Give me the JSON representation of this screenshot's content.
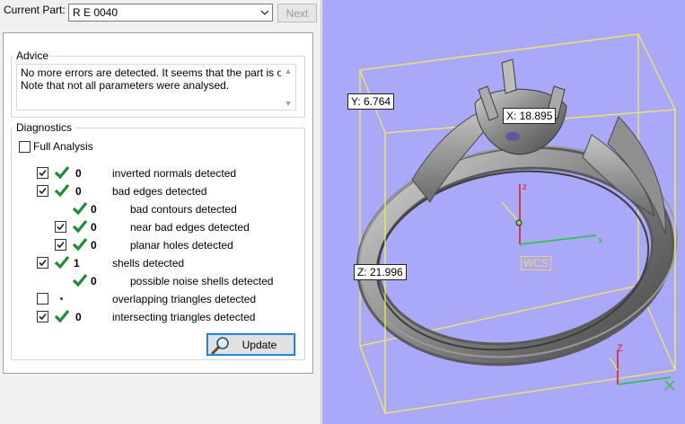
{
  "header": {
    "current_part_label": "Current Part:",
    "current_part_value": "R E 0040",
    "next_button": "Next"
  },
  "advice": {
    "title": "Advice",
    "line1": "No more errors are detected. It seems that the part is ok.",
    "line2": "Note that not all parameters were analysed."
  },
  "diagnostics": {
    "title": "Diagnostics",
    "full_analysis_label": "Full Analysis",
    "full_analysis_checked": false,
    "items": [
      {
        "count": "0",
        "label": "inverted normals detected",
        "checked": true
      },
      {
        "count": "0",
        "label": "bad edges detected",
        "checked": true
      },
      {
        "count": "0",
        "label": "bad contours detected"
      },
      {
        "count": "0",
        "label": "near bad edges detected",
        "checked": true
      },
      {
        "count": "0",
        "label": "planar holes detected",
        "checked": true
      },
      {
        "count": "1",
        "label": "shells detected",
        "checked": true
      },
      {
        "count": "0",
        "label": "possible noise shells detected"
      },
      {
        "count": "",
        "label": "overlapping triangles detected",
        "checked": false
      },
      {
        "count": "0",
        "label": "intersecting triangles detected",
        "checked": true
      }
    ],
    "update_button": "Update"
  },
  "viewport": {
    "background_color": "#aaa8f8",
    "bbox_color": "#f3e85a",
    "dim_y": "Y: 6.764",
    "dim_x": "X: 18.895",
    "dim_z": "Z: 21.996",
    "axis_z": "z",
    "axis_x": "x",
    "wcs_label": "WCS",
    "corner_axis_z": "Z"
  },
  "colors": {
    "check_green": "#1e8a3c",
    "axis_red": "#d82020",
    "axis_green": "#22c43a"
  }
}
